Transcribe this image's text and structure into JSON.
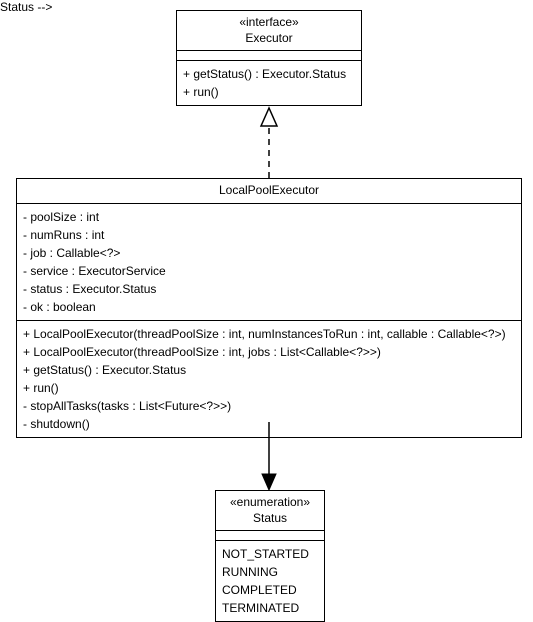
{
  "executor": {
    "stereotype": "«interface»",
    "name": "Executor",
    "methods": [
      "+ getStatus() : Executor.Status",
      "+ run()"
    ]
  },
  "localPool": {
    "name": "LocalPoolExecutor",
    "fields": [
      "- poolSize : int",
      "- numRuns : int",
      "- job : Callable<?>",
      "- service : ExecutorService",
      "- status : Executor.Status",
      "- ok : boolean"
    ],
    "methods": [
      "+ LocalPoolExecutor(threadPoolSize : int, numInstancesToRun : int, callable : Callable<?>)",
      "+ LocalPoolExecutor(threadPoolSize : int, jobs : List<Callable<?>>)",
      "+ getStatus() : Executor.Status",
      "+ run()",
      "- stopAllTasks(tasks : List<Future<?>>)",
      "- shutdown()"
    ]
  },
  "status": {
    "stereotype": "«enumeration»",
    "name": "Status",
    "values": [
      "NOT_STARTED",
      "RUNNING",
      "COMPLETED",
      "TERMINATED"
    ]
  }
}
